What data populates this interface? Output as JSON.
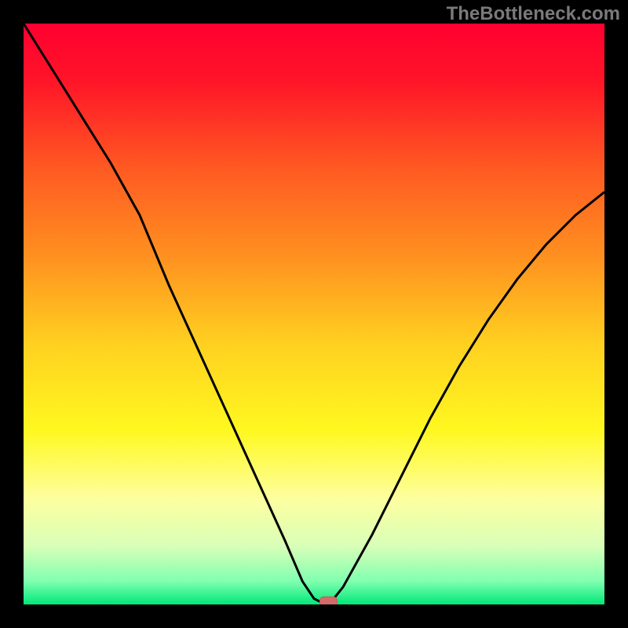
{
  "watermark": "TheBottleneck.com",
  "colors": {
    "gradient_stops": [
      {
        "offset": 0.0,
        "color": "#ff0030"
      },
      {
        "offset": 0.1,
        "color": "#ff1528"
      },
      {
        "offset": 0.25,
        "color": "#ff5a22"
      },
      {
        "offset": 0.4,
        "color": "#ff9020"
      },
      {
        "offset": 0.55,
        "color": "#ffd020"
      },
      {
        "offset": 0.7,
        "color": "#fff820"
      },
      {
        "offset": 0.82,
        "color": "#fdffa0"
      },
      {
        "offset": 0.9,
        "color": "#d8ffb8"
      },
      {
        "offset": 0.96,
        "color": "#80ffb0"
      },
      {
        "offset": 1.0,
        "color": "#00e878"
      }
    ],
    "curve": "#000000",
    "marker_fill": "#d46a6a",
    "marker_stroke": "#c85a5a",
    "frame": "#000000"
  },
  "chart_data": {
    "type": "line",
    "title": "",
    "xlabel": "",
    "ylabel": "",
    "xlim": [
      0,
      100
    ],
    "ylim": [
      0,
      100
    ],
    "x": [
      0,
      5,
      10,
      15,
      20,
      25,
      30,
      35,
      40,
      45,
      48,
      50,
      52,
      53,
      55,
      60,
      65,
      70,
      75,
      80,
      85,
      90,
      95,
      100
    ],
    "values": [
      100,
      92,
      84,
      76,
      67,
      55,
      44,
      33,
      22,
      11,
      4,
      1,
      0,
      0.5,
      3,
      12,
      22,
      32,
      41,
      49,
      56,
      62,
      67,
      71
    ],
    "marker": {
      "x": 52.5,
      "y": 0.5
    }
  }
}
